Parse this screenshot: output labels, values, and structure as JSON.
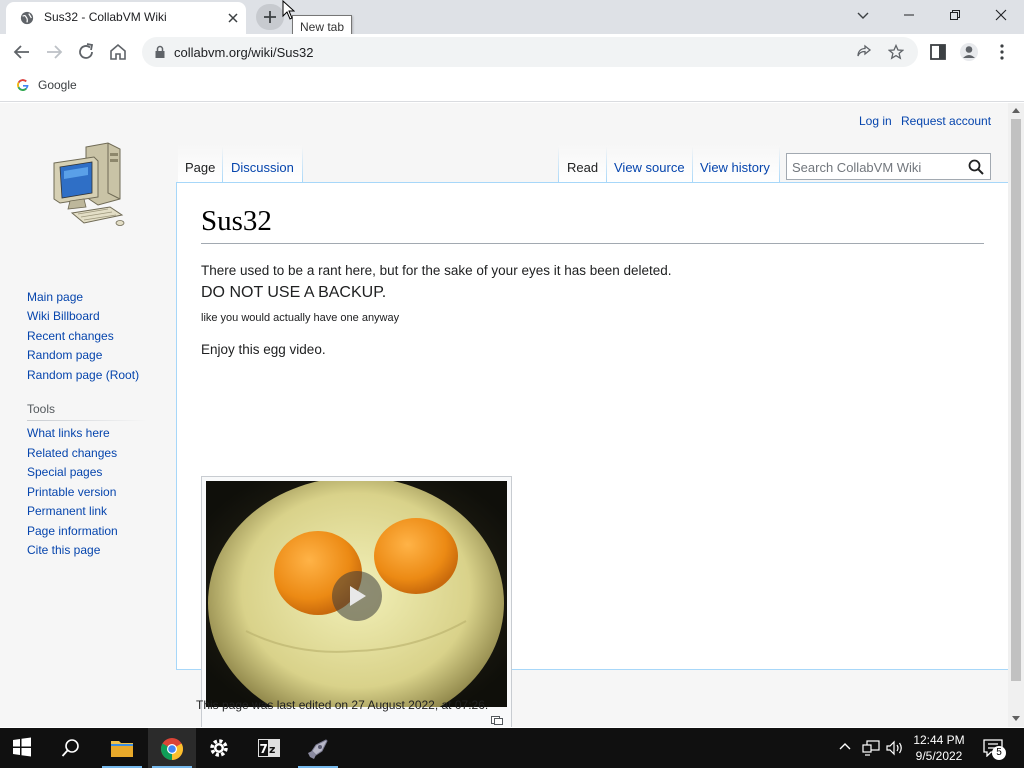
{
  "browser": {
    "tab_title": "Sus32 - CollabVM Wiki",
    "tooltip": "New tab",
    "url": "collabvm.org/wiki/Sus32",
    "bookmark_google": "Google"
  },
  "wiki": {
    "personal": {
      "login": "Log in",
      "request": "Request account"
    },
    "tabs": {
      "page": "Page",
      "discussion": "Discussion",
      "read": "Read",
      "view_source": "View source",
      "view_history": "View history"
    },
    "search_placeholder": "Search CollabVM Wiki",
    "title": "Sus32",
    "body": {
      "p1": "There used to be a rant here, but for the sake of your eyes it has been deleted.",
      "p2": "DO NOT USE A BACKUP.",
      "p3": "like you would actually have one anyway",
      "p4": "Enjoy this egg video."
    },
    "nav": [
      "Main page",
      "Wiki Billboard",
      "Recent changes",
      "Random page",
      "Random page (Root)"
    ],
    "tools_heading": "Tools",
    "tools": [
      "What links here",
      "Related changes",
      "Special pages",
      "Printable version",
      "Permanent link",
      "Page information",
      "Cite this page"
    ],
    "footer": "This page was last edited on 27 August 2022, at 07:26."
  },
  "taskbar": {
    "time": "12:44 PM",
    "date": "9/5/2022",
    "notifications": "5"
  },
  "colors": {
    "link": "#0645ad",
    "border_blue": "#a7d7f9",
    "taskbar": "#101010"
  }
}
